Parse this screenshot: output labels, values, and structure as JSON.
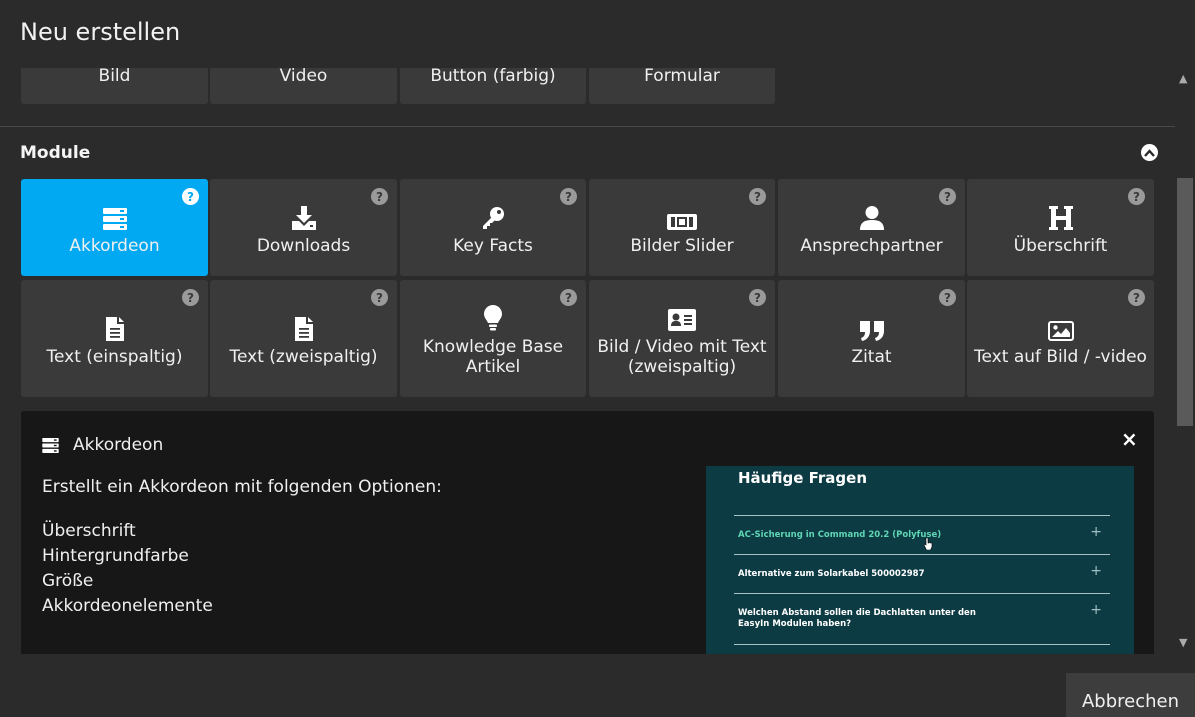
{
  "dialog": {
    "title": "Neu erstellen",
    "cancel_label": "Abbrechen"
  },
  "basic_elements": [
    {
      "label": "Bild"
    },
    {
      "label": "Video"
    },
    {
      "label": "Button (farbig)"
    },
    {
      "label": "Formular"
    }
  ],
  "modules": {
    "title": "Module",
    "help_glyph": "?",
    "tiles": [
      {
        "label": "Akkordeon",
        "icon": "accordion-icon",
        "active": true
      },
      {
        "label": "Downloads",
        "icon": "download-icon"
      },
      {
        "label": "Key Facts",
        "icon": "key-icon"
      },
      {
        "label": "Bilder Slider",
        "icon": "slider-icon"
      },
      {
        "label": "Ansprechpartner",
        "icon": "user-icon"
      },
      {
        "label": "Überschrift",
        "icon": "heading-icon"
      },
      {
        "label": "Text (einspaltig)",
        "icon": "document-icon"
      },
      {
        "label": "Text (zweispaltig)",
        "icon": "document-icon"
      },
      {
        "label": "Knowledge Base Artikel",
        "icon": "lightbulb-icon"
      },
      {
        "label": "Bild / Video mit Text (zweispaltig)",
        "icon": "id-card-icon"
      },
      {
        "label": "Zitat",
        "icon": "quote-icon"
      },
      {
        "label": "Text auf Bild / -video",
        "icon": "image-icon"
      }
    ]
  },
  "info": {
    "title": "Akkordeon",
    "close_glyph": "×",
    "description": "Erstellt ein Akkordeon mit folgenden Optionen:",
    "options": [
      "Überschrift",
      "Hintergrundfarbe",
      "Größe",
      "Akkordeonelemente"
    ],
    "preview": {
      "heading": "Häufige Fragen",
      "items": [
        {
          "text": "AC-Sicherung in Command 20.2 (Polyfuse)",
          "highlighted": true
        },
        {
          "text": "Alternative zum Solarkabel 500002987"
        },
        {
          "text": "Welchen Abstand sollen die Dachlatten unter den EasyIn Modulen haben?"
        }
      ],
      "plus_glyph": "+"
    }
  },
  "colors": {
    "accent": "#00a9f1",
    "background": "#2b2b2b",
    "tile": "#3a3a3a",
    "panel": "#171717",
    "preview_bg": "#0d3b44"
  }
}
